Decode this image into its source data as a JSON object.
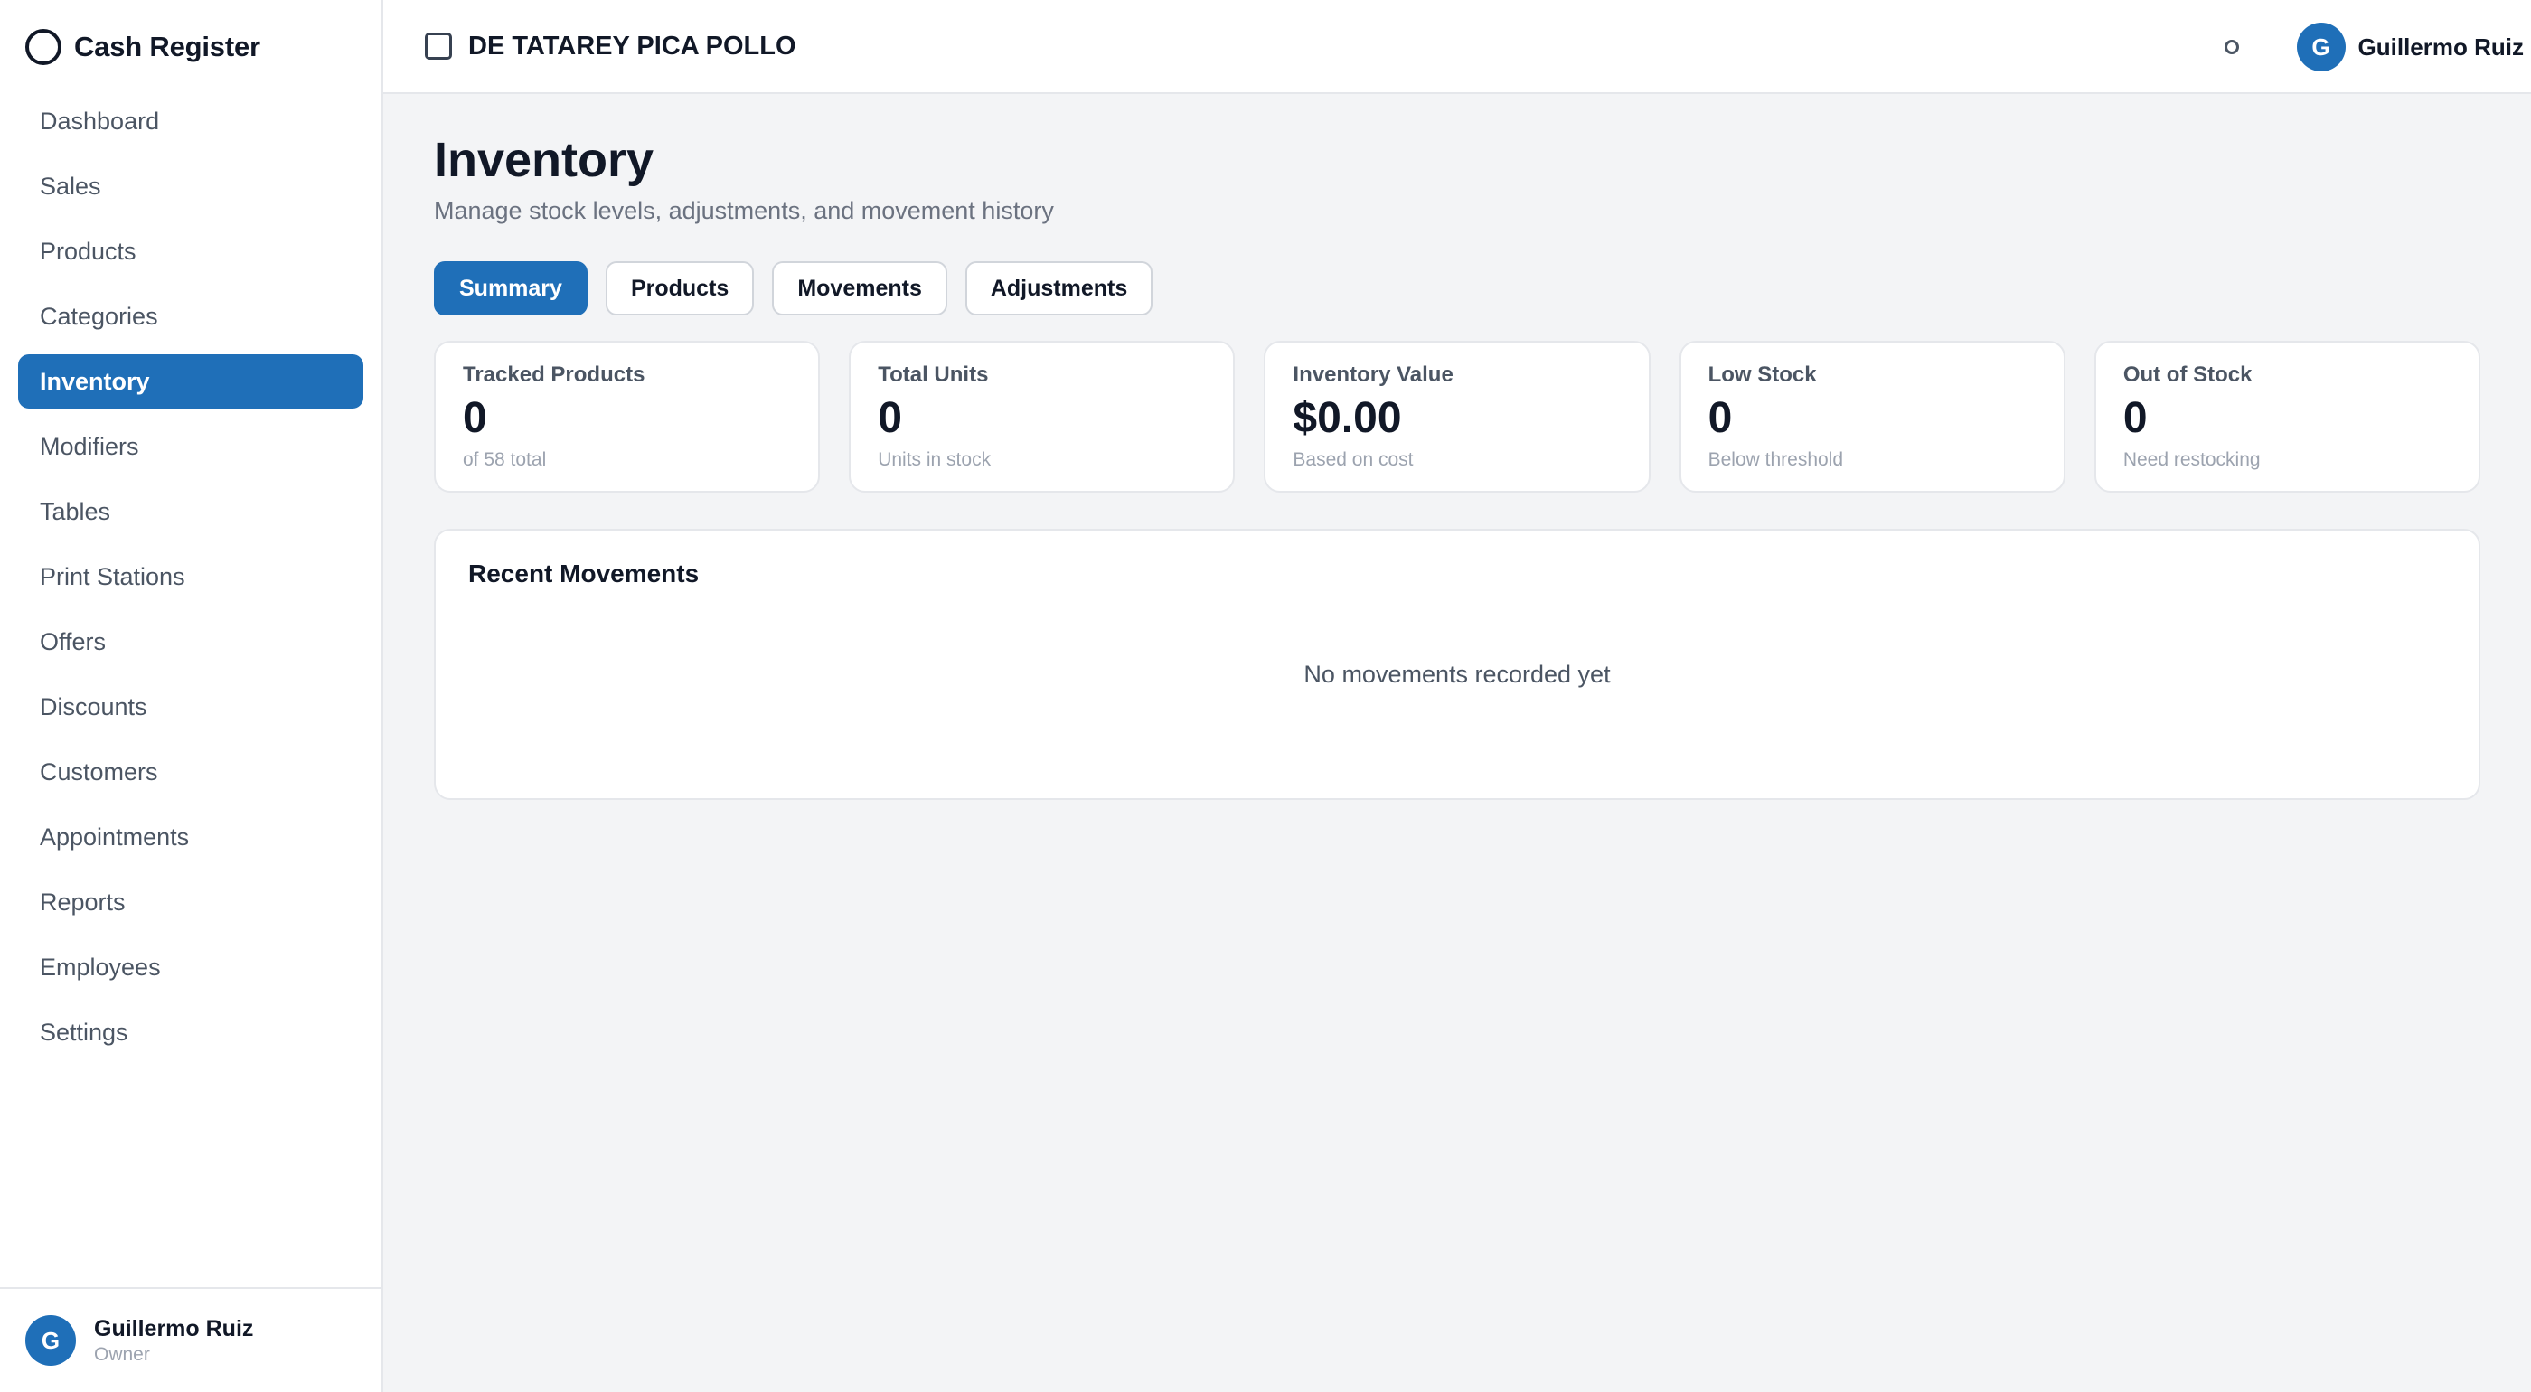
{
  "app": {
    "title": "Cash Register"
  },
  "sidebar": {
    "items": [
      {
        "label": "Dashboard"
      },
      {
        "label": "Sales"
      },
      {
        "label": "Products"
      },
      {
        "label": "Categories"
      },
      {
        "label": "Inventory",
        "active": true
      },
      {
        "label": "Modifiers"
      },
      {
        "label": "Tables"
      },
      {
        "label": "Print Stations"
      },
      {
        "label": "Offers"
      },
      {
        "label": "Discounts"
      },
      {
        "label": "Customers"
      },
      {
        "label": "Appointments"
      },
      {
        "label": "Reports"
      },
      {
        "label": "Employees"
      },
      {
        "label": "Settings"
      }
    ],
    "user": {
      "initial": "G",
      "name": "Guillermo Ruiz",
      "role": "Owner"
    }
  },
  "topbar": {
    "store_name": "DE TATAREY PICA POLLO",
    "user": {
      "initial": "G",
      "name": "Guillermo Ruiz"
    }
  },
  "page": {
    "title": "Inventory",
    "subtitle": "Manage stock levels, adjustments, and movement history",
    "tabs": [
      {
        "label": "Summary",
        "active": true
      },
      {
        "label": "Products"
      },
      {
        "label": "Movements"
      },
      {
        "label": "Adjustments"
      }
    ],
    "cards": [
      {
        "label": "Tracked Products",
        "value": "0",
        "sub": "of 58 total"
      },
      {
        "label": "Total Units",
        "value": "0",
        "sub": "Units in stock"
      },
      {
        "label": "Inventory Value",
        "value": "$0.00",
        "sub": "Based on cost"
      },
      {
        "label": "Low Stock",
        "value": "0",
        "sub": "Below threshold"
      },
      {
        "label": "Out of Stock",
        "value": "0",
        "sub": "Need restocking"
      }
    ],
    "recent_movements": {
      "title": "Recent Movements",
      "empty_text": "No movements recorded yet"
    }
  },
  "colors": {
    "accent": "#1f6fb8",
    "background": "#f3f4f6"
  }
}
